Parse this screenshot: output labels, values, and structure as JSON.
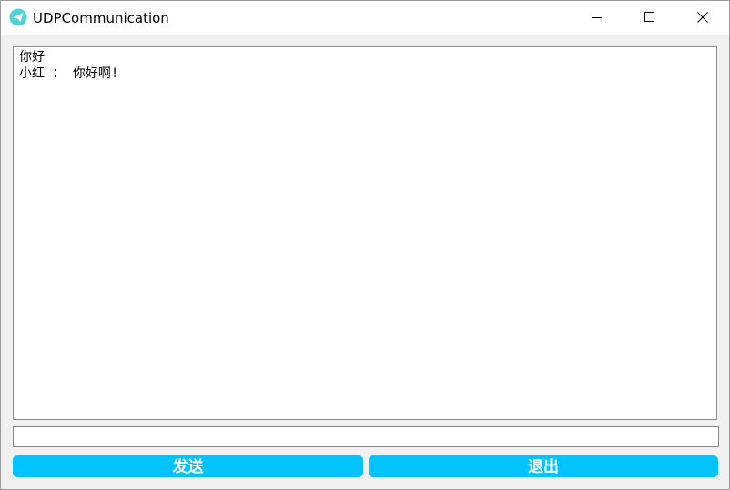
{
  "window": {
    "title": "UDPCommunication",
    "app_icon": "paper-plane-icon",
    "controls": {
      "minimize": "minimize-icon",
      "maximize": "maximize-icon",
      "close": "close-icon"
    }
  },
  "chat": {
    "lines": [
      "你好",
      "小红 ： 你好啊!"
    ]
  },
  "input": {
    "value": "",
    "placeholder": ""
  },
  "buttons": {
    "send_label": "发送",
    "quit_label": "退出"
  },
  "colors": {
    "button_bg": "#00c3ff",
    "button_text": "#ffffff",
    "icon_accent": "#4fd1d9"
  }
}
